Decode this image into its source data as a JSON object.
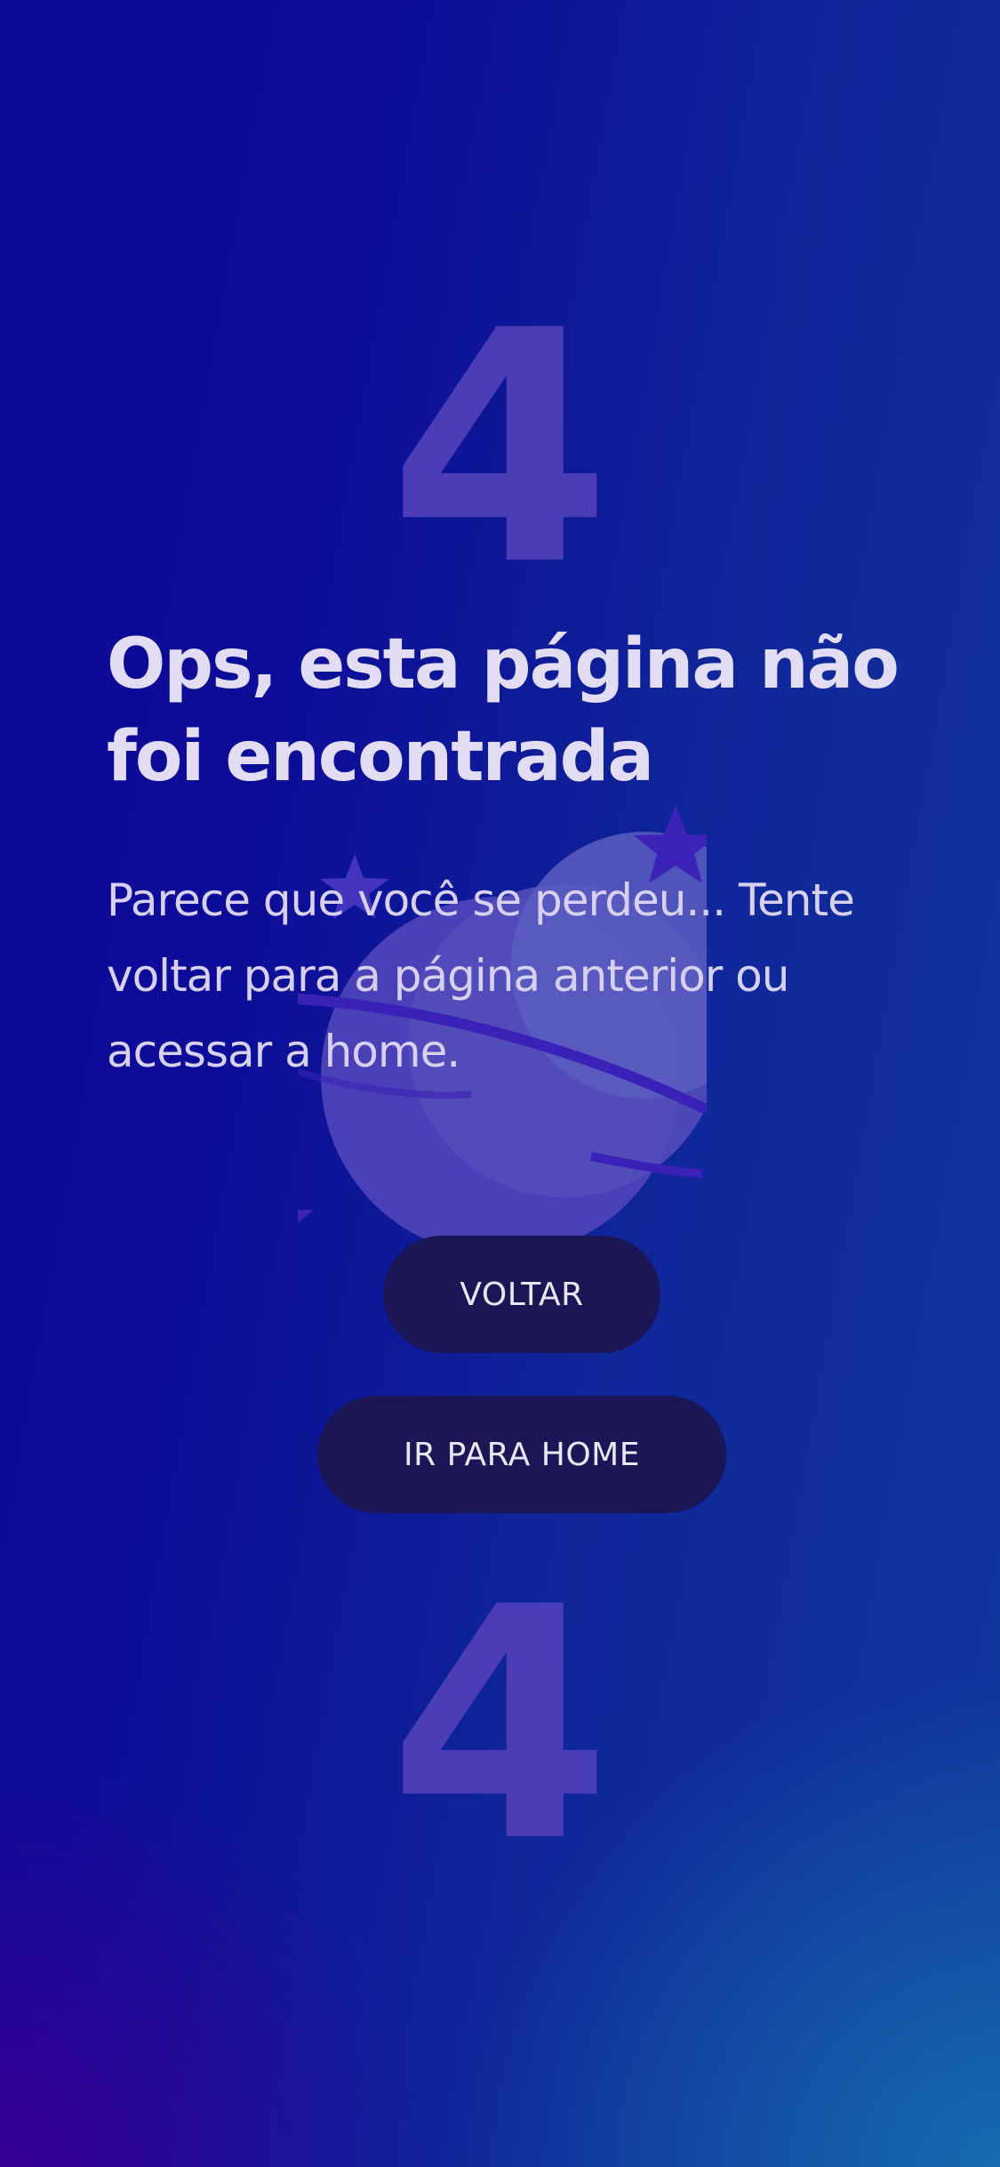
{
  "error_page": {
    "digit_top": "4",
    "digit_bottom": "4",
    "title": "Ops, esta página não foi encontrada",
    "description": "Parece que você se perdeu... Tente voltar para a página anterior ou acessar a home.",
    "back_button_label": "VOLTAR",
    "home_button_label": "IR PARA HOME"
  },
  "illustration": {
    "icon": "planet-with-stars-icon"
  },
  "colors": {
    "background_top": "#0c0796",
    "background_bottom_right": "#166eaf",
    "background_bottom_left": "#3a0096",
    "digit": "#4a3db6",
    "planet": "#4a44b8",
    "title_text": "#e2dcf5",
    "button_background": "#1b1757",
    "button_text": "#e9e6f6"
  }
}
